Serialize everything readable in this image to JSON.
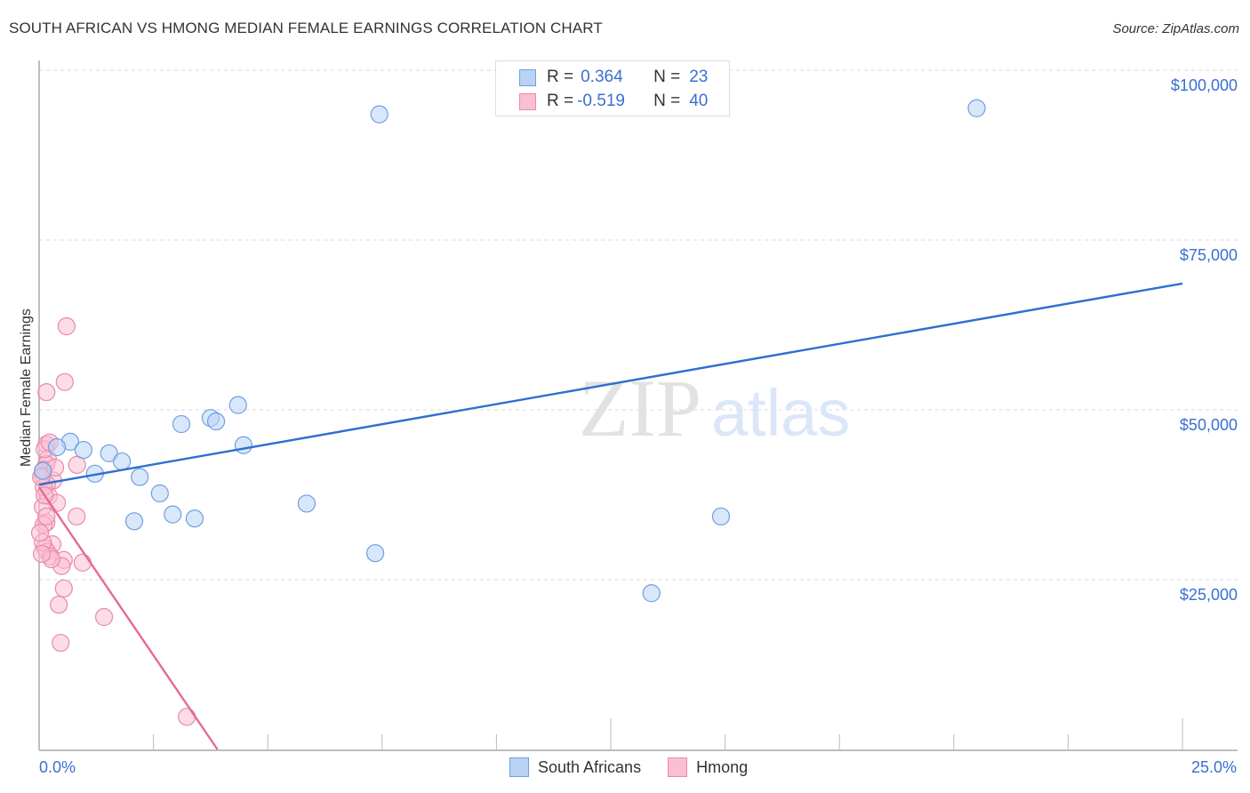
{
  "header": {
    "title": "SOUTH AFRICAN VS HMONG MEDIAN FEMALE EARNINGS CORRELATION CHART",
    "source": "Source: ZipAtlas.com"
  },
  "legend": {
    "rows": [
      {
        "r_label": "R =",
        "r_value": "0.364",
        "n_label": "N =",
        "n_value": "23"
      },
      {
        "r_label": "R =",
        "r_value": "-0.519",
        "n_label": "N =",
        "n_value": "40"
      }
    ]
  },
  "bottom_legend": [
    "South Africans",
    "Hmong"
  ],
  "colors": {
    "blue_fill": "#b9d3f5",
    "blue_stroke": "#6f9fe0",
    "blue_line": "#2f6fd0",
    "pink_fill": "#f9c0d2",
    "pink_stroke": "#ea8aa8",
    "pink_line": "#e46a92",
    "axis_text": "#3a6fd0"
  },
  "watermark": {
    "zip": "ZIP",
    "atlas": "atlas"
  },
  "chart_data": {
    "type": "scatter",
    "title": "SOUTH AFRICAN VS HMONG MEDIAN FEMALE EARNINGS CORRELATION CHART",
    "xlabel": "",
    "ylabel": "Median Female Earnings",
    "xlim": [
      0,
      25
    ],
    "ylim": [
      0,
      100000
    ],
    "x_tick_labels": [
      "0.0%",
      "25.0%"
    ],
    "y_ticks": [
      25000,
      50000,
      75000,
      100000
    ],
    "y_tick_labels": [
      "$25,000",
      "$50,000",
      "$75,000",
      "$100,000"
    ],
    "grid": true,
    "legend_position": "top-center",
    "series": [
      {
        "name": "South Africans",
        "r": 0.364,
        "n": 23,
        "points": [
          [
            7.44,
            93500
          ],
          [
            20.5,
            94400
          ],
          [
            4.35,
            50700
          ],
          [
            3.75,
            48800
          ],
          [
            3.87,
            48300
          ],
          [
            3.11,
            47900
          ],
          [
            4.47,
            44800
          ],
          [
            0.68,
            45300
          ],
          [
            0.39,
            44500
          ],
          [
            0.97,
            44100
          ],
          [
            1.53,
            43600
          ],
          [
            1.81,
            42400
          ],
          [
            1.22,
            40600
          ],
          [
            2.2,
            40100
          ],
          [
            0.08,
            41000
          ],
          [
            2.64,
            37700
          ],
          [
            5.85,
            36200
          ],
          [
            2.92,
            34600
          ],
          [
            3.4,
            34000
          ],
          [
            2.08,
            33600
          ],
          [
            14.91,
            34300
          ],
          [
            7.35,
            28900
          ],
          [
            13.39,
            23000
          ]
        ],
        "trend": {
          "x": [
            0,
            25
          ],
          "y": [
            39000,
            68600
          ]
        }
      },
      {
        "name": "Hmong",
        "r": -0.519,
        "n": 40,
        "points": [
          [
            0.6,
            62300
          ],
          [
            0.56,
            54100
          ],
          [
            0.16,
            52600
          ],
          [
            0.16,
            44900
          ],
          [
            0.19,
            42800
          ],
          [
            0.16,
            42000
          ],
          [
            0.1,
            41200
          ],
          [
            0.08,
            40300
          ],
          [
            0.83,
            41900
          ],
          [
            0.31,
            39600
          ],
          [
            0.17,
            39000
          ],
          [
            0.21,
            37300
          ],
          [
            0.39,
            36300
          ],
          [
            0.08,
            35700
          ],
          [
            0.82,
            34300
          ],
          [
            0.16,
            33400
          ],
          [
            0.1,
            33100
          ],
          [
            0.29,
            30200
          ],
          [
            0.12,
            29700
          ],
          [
            0.17,
            29100
          ],
          [
            0.25,
            28400
          ],
          [
            0.54,
            27900
          ],
          [
            0.95,
            27500
          ],
          [
            0.49,
            27000
          ],
          [
            0.54,
            23700
          ],
          [
            0.43,
            21300
          ],
          [
            1.42,
            19500
          ],
          [
            0.47,
            15700
          ],
          [
            3.23,
            4800
          ],
          [
            0.1,
            38600
          ],
          [
            0.16,
            34300
          ],
          [
            0.27,
            28000
          ],
          [
            0.08,
            30500
          ],
          [
            0.02,
            31900
          ],
          [
            0.12,
            44200
          ],
          [
            0.23,
            45200
          ],
          [
            0.04,
            40100
          ],
          [
            0.35,
            41500
          ],
          [
            0.12,
            37400
          ],
          [
            0.06,
            28800
          ]
        ],
        "trend": {
          "x": [
            0,
            3.9
          ],
          "y": [
            38600,
            0
          ]
        }
      }
    ]
  }
}
